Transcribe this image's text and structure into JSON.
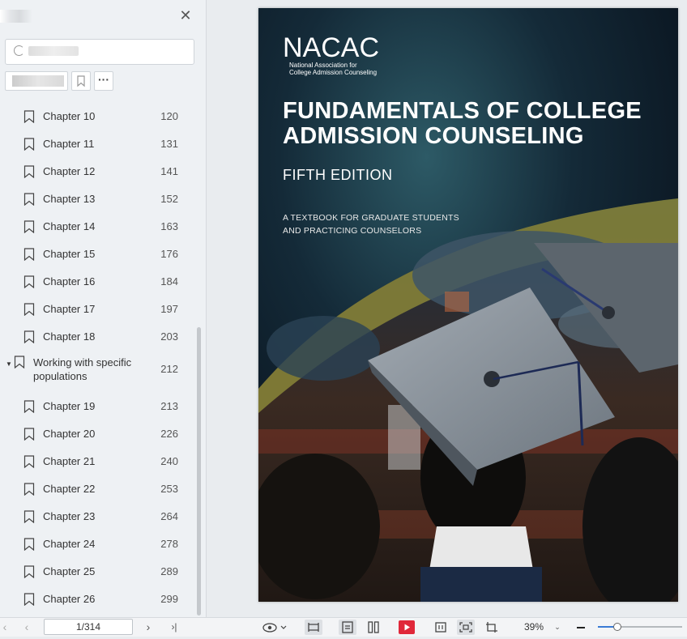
{
  "sidebar": {
    "search": {
      "value": "",
      "placeholder": ""
    },
    "toc": [
      {
        "label": "Chapter 10",
        "page": "120"
      },
      {
        "label": "Chapter 11",
        "page": "131"
      },
      {
        "label": "Chapter 12",
        "page": "141"
      },
      {
        "label": "Chapter 13",
        "page": "152"
      },
      {
        "label": "Chapter 14",
        "page": "163"
      },
      {
        "label": "Chapter 15",
        "page": "176"
      },
      {
        "label": "Chapter 16",
        "page": "184"
      },
      {
        "label": "Chapter 17",
        "page": "197"
      },
      {
        "label": "Chapter 18",
        "page": "203"
      },
      {
        "label": "Working with specific populations",
        "page": "212",
        "expanded": true
      },
      {
        "label": "Chapter 19",
        "page": "213"
      },
      {
        "label": "Chapter 20",
        "page": "226"
      },
      {
        "label": "Chapter 21",
        "page": "240"
      },
      {
        "label": "Chapter 22",
        "page": "253"
      },
      {
        "label": "Chapter 23",
        "page": "264"
      },
      {
        "label": "Chapter 24",
        "page": "278"
      },
      {
        "label": "Chapter 25",
        "page": "289"
      },
      {
        "label": "Chapter 26",
        "page": "299"
      }
    ],
    "close_icon": "close-icon",
    "more_label": "···"
  },
  "cover": {
    "logo": "NACAC",
    "logo_sub_1": "National Association for",
    "logo_sub_2": "College Admission Counseling",
    "title_1": "FUNDAMENTALS OF COLLEGE",
    "title_2": "ADMISSION COUNSELING",
    "edition": "FIFTH EDITION",
    "subtitle_1": "A TEXTBOOK FOR GRADUATE STUDENTS",
    "subtitle_2": "AND PRACTICING COUNSELORS"
  },
  "bottombar": {
    "page_indicator": "1/314",
    "zoom": "39%",
    "zoom_level": 0.22,
    "icons": [
      "prev-page-icon",
      "next-page-icon",
      "last-page-icon",
      "eye-icon",
      "fit-width-icon",
      "single-page-icon",
      "two-page-icon",
      "play-icon",
      "fit-page-icon",
      "actual-size-icon",
      "crop-icon",
      "zoom-out-icon"
    ]
  },
  "colors": {
    "accent": "#3a7bd5",
    "play": "#e0283a",
    "sidebar_bg": "#eef1f4"
  }
}
